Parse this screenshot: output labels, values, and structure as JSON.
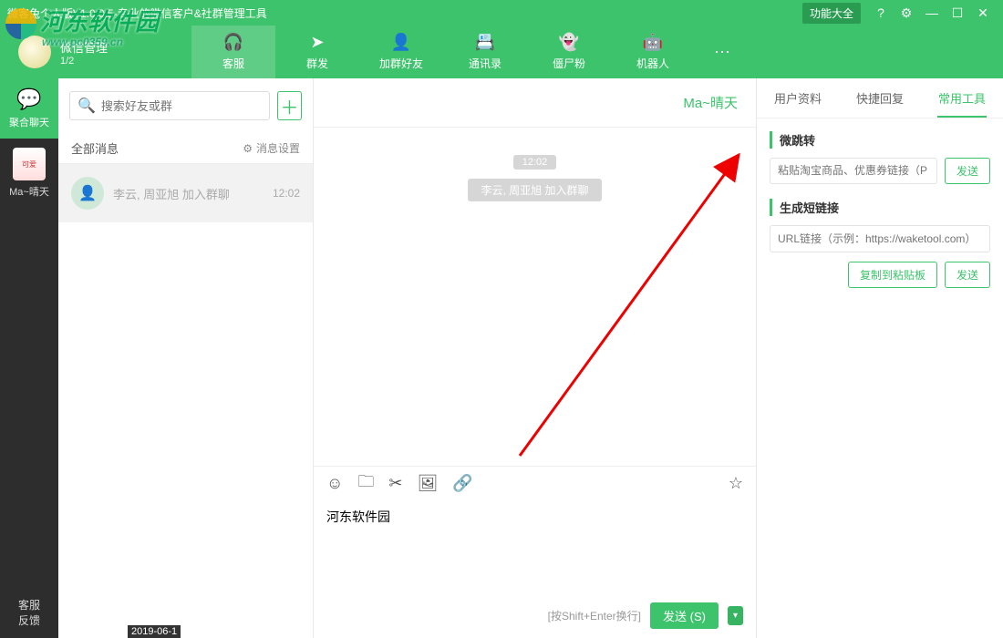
{
  "titlebar": {
    "title": "微客兔个人版V1.0.0.5-专业的微信客户&社群管理工具",
    "features_btn": "功能大全"
  },
  "nav": {
    "lead_label": "微信管理",
    "lead_sub": "1/2",
    "items": [
      {
        "label": "客服"
      },
      {
        "label": "群发"
      },
      {
        "label": "加群好友"
      },
      {
        "label": "通讯录"
      },
      {
        "label": "僵尸粉"
      },
      {
        "label": "机器人"
      }
    ]
  },
  "sidebar": {
    "items": [
      {
        "label": "聚合聊天"
      },
      {
        "label": "Ma~晴天"
      }
    ],
    "footer": "客服\n反馈"
  },
  "convlist": {
    "search_placeholder": "搜索好友或群",
    "filter_all": "全部消息",
    "msg_settings": "消息设置",
    "items": [
      {
        "text": "李云, 周亚旭 加入群聊",
        "time": "12:02"
      }
    ]
  },
  "chat": {
    "title": "Ma~晴天",
    "time_pill": "12:02",
    "sys_msg": "李云, 周亚旭 加入群聊",
    "input_value": "河东软件园",
    "hint": "[按Shift+Enter换行]",
    "send_label": "发送 (S)"
  },
  "right": {
    "tabs": [
      "用户资料",
      "快捷回复",
      "常用工具"
    ],
    "active_tab": 2,
    "sec1_title": "微跳转",
    "sec1_placeholder": "粘贴淘宝商品、优惠券链接（P",
    "sec1_btn": "发送",
    "sec2_title": "生成短链接",
    "sec2_placeholder": "URL链接（示例：https://waketool.com）",
    "sec2_btn1": "复制到粘贴板",
    "sec2_btn2": "发送"
  },
  "watermark": {
    "text": "河东软件园",
    "url": "www.pc0359.cn"
  },
  "footer_date": "2019-06-1"
}
